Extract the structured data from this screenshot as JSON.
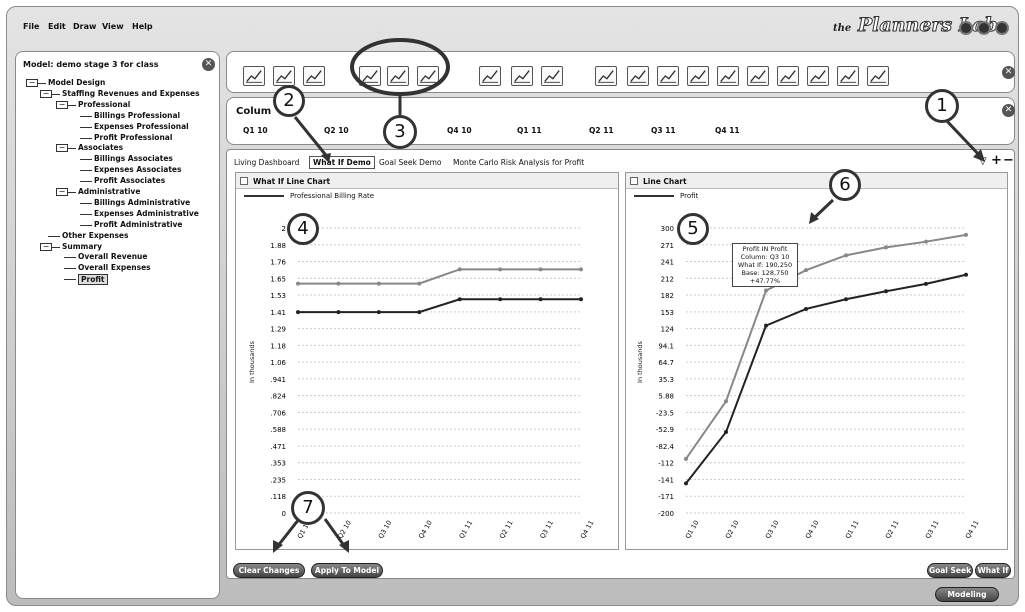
{
  "menu": [
    "File",
    "Edit",
    "Draw",
    "View",
    "Help"
  ],
  "brand": {
    "prefix": "the",
    "name": "Planners Lab"
  },
  "model": {
    "title": "Model:  demo stage 3 for class"
  },
  "tree": [
    {
      "label": "Model Design",
      "lvl": 0,
      "box": "−"
    },
    {
      "label": "Staffing Revenues and Expenses",
      "lvl": 1,
      "box": "−"
    },
    {
      "label": "Professional",
      "lvl": 2,
      "box": "−"
    },
    {
      "label": "Billings Professional",
      "lvl": 3
    },
    {
      "label": "Expenses Professional",
      "lvl": 3
    },
    {
      "label": "Profit Professional",
      "lvl": 3
    },
    {
      "label": "Associates",
      "lvl": 2,
      "box": "−"
    },
    {
      "label": "Billings Associates",
      "lvl": 3
    },
    {
      "label": "Expenses Associates",
      "lvl": 3
    },
    {
      "label": "Profit Associates",
      "lvl": 3
    },
    {
      "label": "Administrative",
      "lvl": 2,
      "box": "−"
    },
    {
      "label": "Billings Administrative",
      "lvl": 3
    },
    {
      "label": "Expenses Administrative",
      "lvl": 3
    },
    {
      "label": "Profit  Administrative",
      "lvl": 3
    },
    {
      "label": "Other Expenses",
      "lvl": 1
    },
    {
      "label": "Summary",
      "lvl": 1,
      "box": "−"
    },
    {
      "label": "Overall Revenue",
      "lvl": 2
    },
    {
      "label": "Overall Expenses",
      "lvl": 2
    },
    {
      "label": "Profit",
      "lvl": 2,
      "selected": true
    }
  ],
  "columns_panel": {
    "title": "Colum",
    "items": [
      "Q1 10",
      "Q2 10",
      "Q4 10",
      "Q1 11",
      "Q2 11",
      "Q3 11",
      "Q4 11"
    ]
  },
  "tabs": [
    "Living Dashboard",
    "What If Demo",
    "Goal Seek Demo",
    "Monte Carlo Risk Analysis for Profit"
  ],
  "tab_controls": [
    "▽",
    "+",
    "−"
  ],
  "left_chart": {
    "title": "What If Line Chart",
    "legend": "Professional Billing Rate",
    "yaxis_label": "In thousands",
    "yticks": [
      "2",
      "1.88",
      "1.76",
      "1.65",
      "1.53",
      "1.41",
      "1.29",
      "1.18",
      "1.06",
      ".941",
      ".824",
      ".706",
      ".588",
      ".471",
      ".353",
      ".235",
      ".118",
      "0"
    ]
  },
  "right_chart": {
    "title": "Line Chart",
    "legend": "Profit",
    "yaxis_label": "In thousands",
    "yticks": [
      "300",
      "271",
      "241",
      "212",
      "182",
      "153",
      "124",
      "94.1",
      "64.7",
      "35.3",
      "5.88",
      "-23.5",
      "-52.9",
      "-82.4",
      "-112",
      "-141",
      "-171",
      "-200"
    ]
  },
  "tooltip": [
    "Profit IN Profit",
    "Column: Q3 10",
    "What If: 190,250",
    "Base: 128,750",
    "+47.77%"
  ],
  "buttons": {
    "clear": "Clear Changes",
    "apply": "Apply To Model",
    "goal_seek": "Goal Seek",
    "what_if": "What If",
    "modeling": "Modeling"
  },
  "callouts": [
    "1",
    "2",
    "3",
    "4",
    "5",
    "6",
    "7"
  ],
  "chart_data": [
    {
      "type": "line",
      "title": "What If Line Chart",
      "ylabel": "In thousands",
      "ylim": [
        0,
        2
      ],
      "categories": [
        "Q1 10",
        "Q2 10",
        "Q3 10",
        "Q4 10",
        "Q1 11",
        "Q2 11",
        "Q3 11",
        "Q4 11"
      ],
      "series": [
        {
          "name": "Professional Billing Rate",
          "values": [
            1.41,
            1.41,
            1.41,
            1.41,
            1.5,
            1.5,
            1.5,
            1.5
          ]
        },
        {
          "values": [
            1.61,
            1.61,
            1.61,
            1.61,
            1.71,
            1.71,
            1.71,
            1.71
          ]
        }
      ]
    },
    {
      "type": "line",
      "title": "Line Chart",
      "ylabel": "In thousands",
      "ylim": [
        -200,
        300
      ],
      "categories": [
        "Q1 10",
        "Q2 10",
        "Q3 10",
        "Q4 10",
        "Q1 11",
        "Q2 11",
        "Q3 11",
        "Q4 11"
      ],
      "series": [
        {
          "name": "Profit",
          "values": [
            -148,
            -58,
            128.75,
            158,
            175,
            189,
            202,
            218
          ]
        },
        {
          "values": [
            -105,
            -4,
            190.25,
            226,
            252,
            266,
            276,
            288
          ]
        }
      ]
    }
  ]
}
